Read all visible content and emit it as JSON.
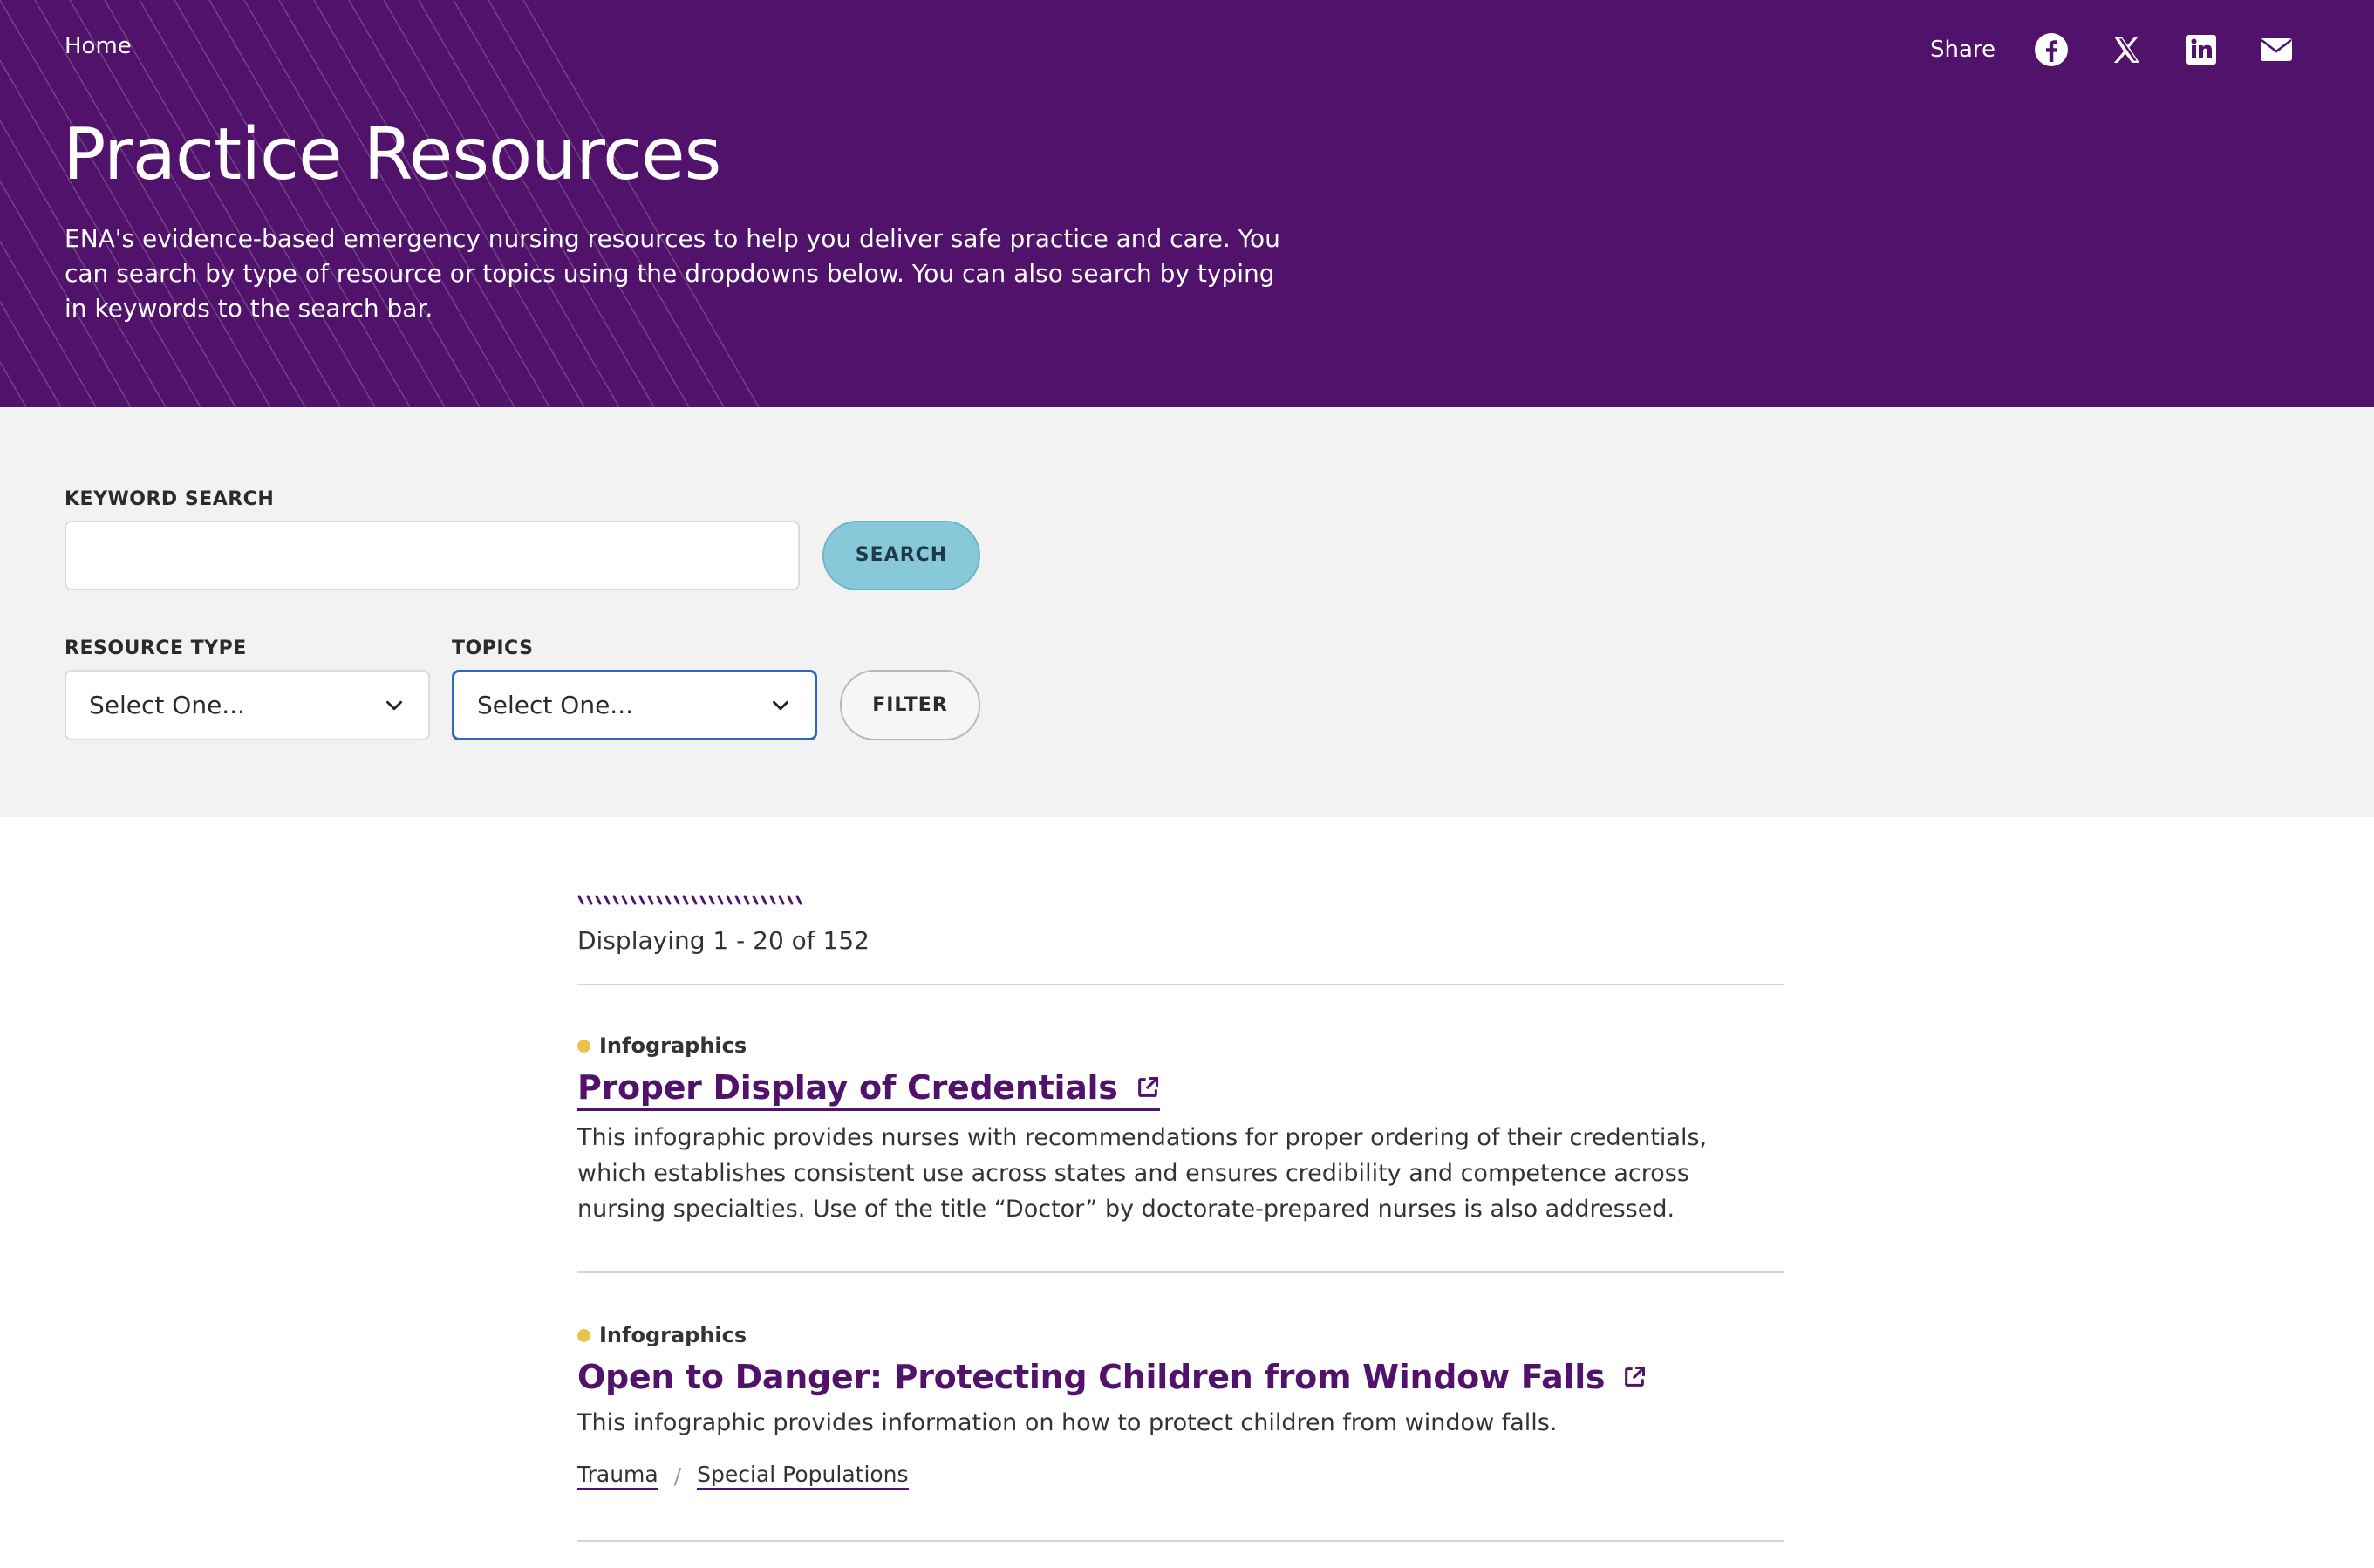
{
  "hero": {
    "breadcrumb": "Home",
    "title": "Practice Resources",
    "intro": "ENA's evidence-based emergency nursing resources to help you deliver safe practice and care. You can search by type of resource or topics using the dropdowns below. You can also search by typing in keywords to the search bar.",
    "background_color": "#50126a",
    "share": {
      "label": "Share",
      "icons": [
        "facebook-icon",
        "x-icon",
        "linkedin-icon",
        "email-icon"
      ]
    }
  },
  "filters": {
    "keyword_label": "KEYWORD SEARCH",
    "keyword_value": "",
    "keyword_placeholder": "",
    "search_button": "SEARCH",
    "resource_type_label": "RESOURCE TYPE",
    "resource_type_value": "Select One...",
    "topics_label": "TOPICS",
    "topics_value": "Select One...",
    "filter_button": "FILTER",
    "search_button_color": "#87c9d8"
  },
  "results": {
    "count_text": "Displaying 1 - 20 of 152",
    "items": [
      {
        "tag": "Infographics",
        "title": "Proper Display of Credentials",
        "description": "This infographic provides nurses with recommendations for proper ordering of their credentials, which establishes consistent use across states and ensures credibility and competence across nursing specialties. Use of the title “Doctor” by doctorate-prepared nurses is also addressed."
      },
      {
        "tag": "Infographics",
        "title": "Open to Danger: Protecting Children from Window Falls",
        "description": "This infographic provides information on how to protect children from window falls.",
        "topics": [
          "Trauma",
          "Special Populations"
        ],
        "topic_separator": "/"
      }
    ],
    "tag_dot_color": "#e9c24a",
    "title_color": "#50126a"
  }
}
